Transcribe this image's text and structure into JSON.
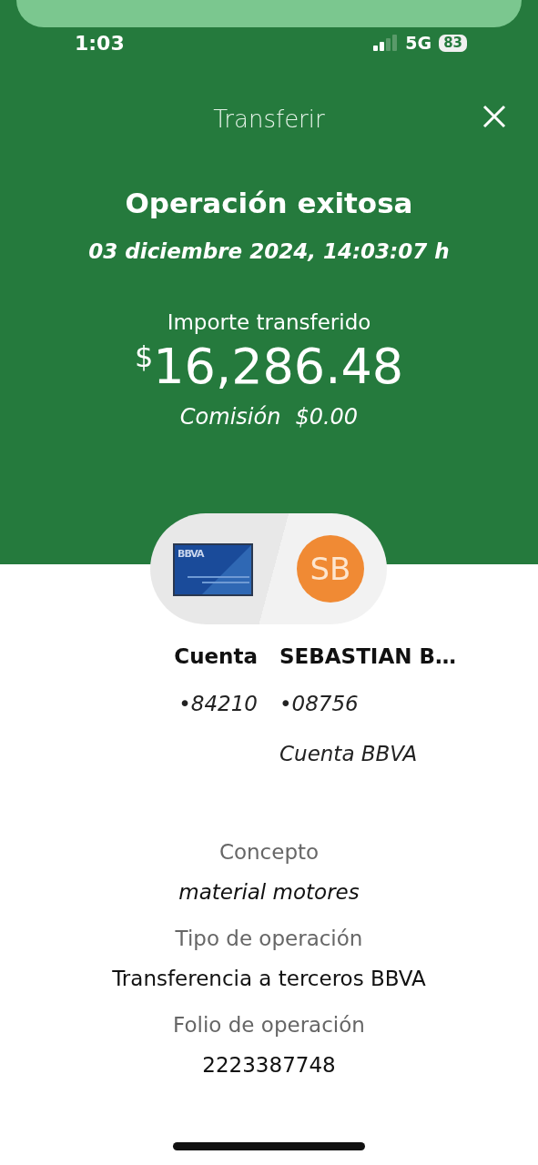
{
  "status_bar": {
    "time": "1:03",
    "network": "5G",
    "battery": "83"
  },
  "header": {
    "title": "Transferir"
  },
  "result": {
    "title": "Operación exitosa",
    "datetime": "03 diciembre 2024, 14:03:07 h",
    "amount_label": "Importe transferido",
    "currency": "$",
    "amount": "16,286.48",
    "fee_label": "Comisión",
    "fee": "$0.00"
  },
  "origin": {
    "card_label": "BBVA",
    "name": "Cuenta",
    "number": "•84210"
  },
  "destination": {
    "initials": "SB",
    "name": "SEBASTIAN B…",
    "number": "•08756",
    "bank": "Cuenta BBVA"
  },
  "details": [
    {
      "label": "Concepto",
      "value": "material motores",
      "kind": "italic"
    },
    {
      "label": "Tipo de operación",
      "value": "Transferencia a terceros BBVA",
      "kind": "plain"
    },
    {
      "label": "Folio de operación",
      "value": "2223387748",
      "kind": "plain"
    }
  ]
}
